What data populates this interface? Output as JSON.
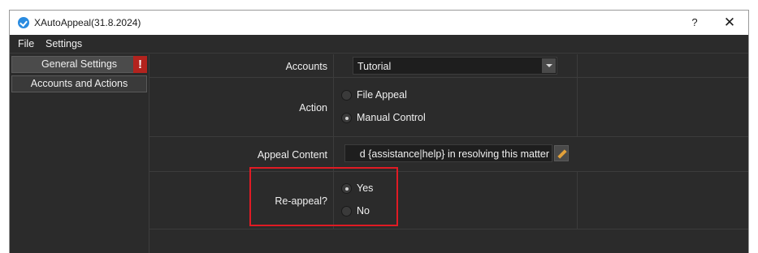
{
  "window": {
    "title": "XAutoAppeal(31.8.2024)",
    "help": "?",
    "close": "✕"
  },
  "menu": {
    "file": "File",
    "settings": "Settings"
  },
  "sidebar": {
    "items": [
      {
        "label": "General Settings",
        "badge": "!"
      },
      {
        "label": "Accounts and Actions"
      }
    ]
  },
  "form": {
    "accounts": {
      "label": "Accounts",
      "value": "Tutorial"
    },
    "action": {
      "label": "Action",
      "options": [
        "File Appeal",
        "Manual Control"
      ],
      "selected": "Manual Control"
    },
    "appeal_content": {
      "label": "Appeal Content",
      "value": "d {assistance|help} in resolving this matter"
    },
    "reappeal": {
      "label": "Re-appeal?",
      "options": [
        "Yes",
        "No"
      ],
      "selected": "Yes"
    }
  },
  "colors": {
    "background": "#2b2b2b",
    "warning": "#b3231e",
    "highlight": "#e01b24"
  }
}
